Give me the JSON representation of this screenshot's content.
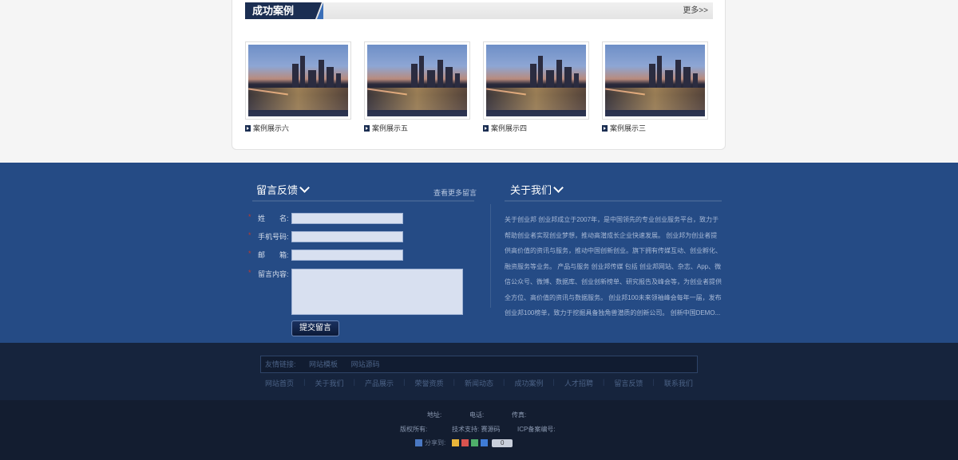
{
  "cases": {
    "title": "成功案例",
    "more": "更多>>",
    "items": [
      {
        "label": "案例展示六"
      },
      {
        "label": "案例展示五"
      },
      {
        "label": "案例展示四"
      },
      {
        "label": "案例展示三"
      }
    ]
  },
  "feedback": {
    "title": "留言反馈",
    "more": "查看更多留言",
    "name_label": "姓　　名:",
    "phone_label": "手机号码:",
    "email_label": "邮　　箱:",
    "content_label": "留言内容:",
    "required_mark": "*",
    "submit": "提交留言"
  },
  "about": {
    "title": "关于我们",
    "text": "关于创业邦 创业邦成立于2007年，是中国领先的专业创业服务平台，致力于帮助创业者实现创业梦想，推动高潜成长企业快速发展。 创业邦为创业者提供高价值的资讯与服务，推动中国创新创业。旗下拥有传媒互动、创业孵化、融资服务等业务。 产品与服务 创业邦传媒 包括 创业邦网站、杂志、App、微信公众号、微博、数据库、创业创新榜单、研究报告及峰会等，为创业者提供全方位、高价值的资讯与数据服务。 创业邦100未来领袖峰会每年一届，发布 创业邦100榜单，致力于挖掘具备独角兽潜质的创新公司。 创新中国DEMO..."
  },
  "friend_links": {
    "label": "友情链接:",
    "items": [
      "网站模板",
      "网站源码"
    ]
  },
  "nav": [
    "网站首页",
    "关于我们",
    "产品展示",
    "荣誉资质",
    "新闻动态",
    "成功案例",
    "人才招聘",
    "留言反馈",
    "联系我们"
  ],
  "footer": {
    "address": "地址:",
    "phone": "电话:",
    "fax": "传真:",
    "copyright": "版权所有:",
    "tech": "技术支持: 赛源码",
    "icp": "ICP备案编号:",
    "share_label": "分享到:",
    "share_count": "0"
  },
  "colors": {
    "blue_bg": "#254b85",
    "dark_bg": "#16243d",
    "title_bar": "#1b2e52"
  }
}
